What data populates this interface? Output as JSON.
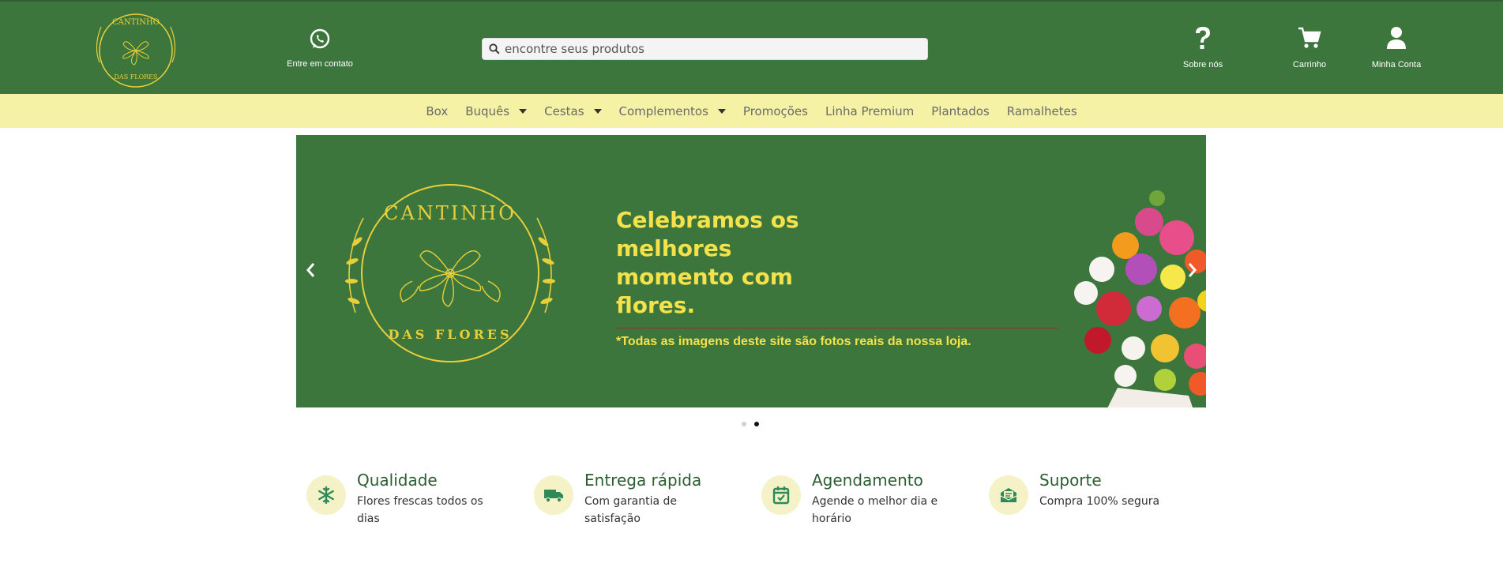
{
  "header": {
    "logo_top_text": "CANTINHO",
    "logo_bottom_text": "DAS FLORES",
    "contact_label": "Entre em contato",
    "contact_icon": "whatsapp-icon",
    "search_placeholder": "encontre seus produtos",
    "about_label": "Sobre nós",
    "about_icon": "question-icon",
    "cart_label": "Carrinho",
    "cart_icon": "cart-icon",
    "account_label": "Minha Conta",
    "account_icon": "user-icon"
  },
  "nav": {
    "items": [
      {
        "label": "Box"
      },
      {
        "label": "Buquês"
      },
      {
        "label": "Cestas"
      },
      {
        "label": "Complementos"
      },
      {
        "label": "Promoções"
      },
      {
        "label": "Linha Premium"
      },
      {
        "label": "Plantados"
      },
      {
        "label": "Ramalhetes"
      }
    ]
  },
  "banner": {
    "logo_top_text": "CANTINHO",
    "logo_bottom_text": "DAS FLORES",
    "headline": [
      "Celebramos os",
      "melhores",
      "momento com",
      "flores."
    ],
    "disclaimer": "*Todas as imagens deste site são fotos reais da nossa loja.",
    "prev_icon": "chevron-left-icon",
    "next_icon": "chevron-right-icon"
  },
  "carousel": {
    "slides": 2,
    "active_slide": 2
  },
  "features": [
    {
      "title": "Qualidade",
      "desc": "Flores frescas todos os dias",
      "icon": "snowflake-icon"
    },
    {
      "title": "Entrega rápida",
      "desc": "Com garantia de satisfação",
      "icon": "truck-icon"
    },
    {
      "title": "Agendamento",
      "desc": "Agende o melhor dia e horário",
      "icon": "calendar-check-icon"
    },
    {
      "title": "Suporte",
      "desc": "Compra 100% segura",
      "icon": "envelope-icon"
    }
  ],
  "colors": {
    "header_bg": "#3c763d",
    "nav_bg": "#f5f2a6",
    "accent_yellow": "#f5e24a",
    "feature_title": "#2d5e33"
  }
}
